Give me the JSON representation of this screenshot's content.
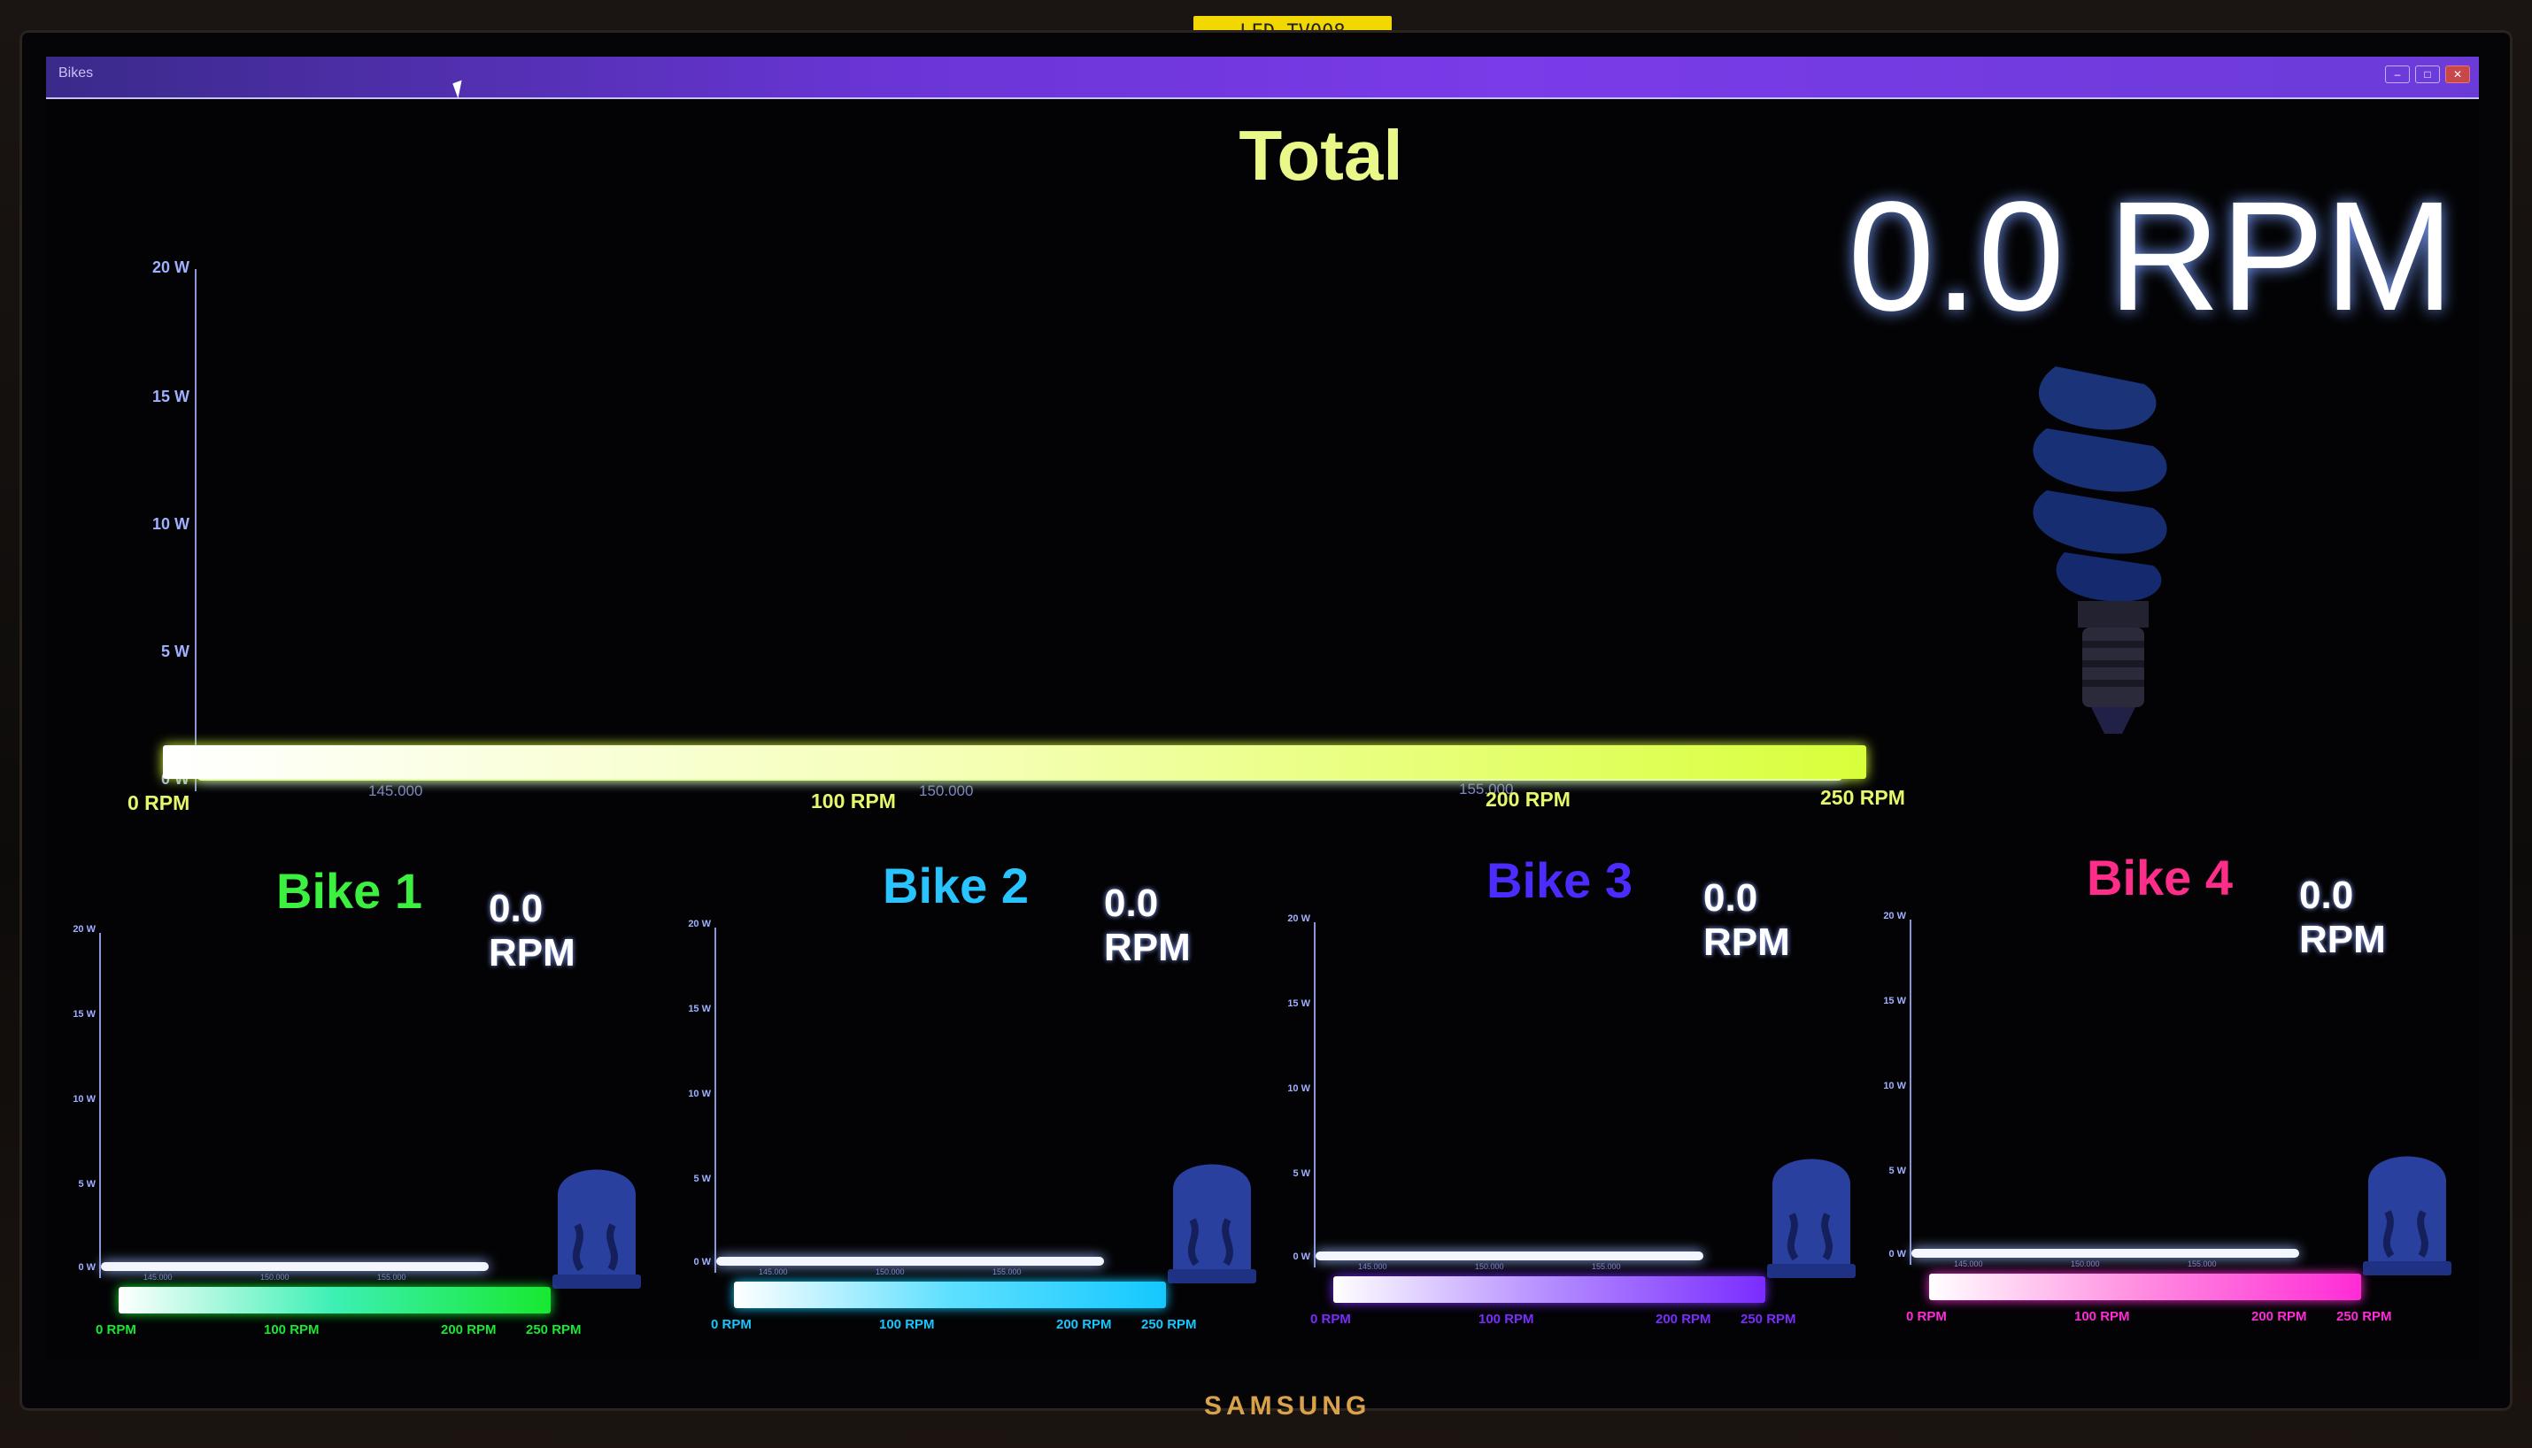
{
  "monitor": {
    "asset_tag": "LED TV008",
    "brand": "SAMSUNG"
  },
  "window": {
    "title": "Bikes",
    "controls": [
      "–",
      "□",
      "✕"
    ]
  },
  "total": {
    "title": "Total",
    "rpm_display": "0.0 RPM",
    "icon": "lightbulb-icon",
    "power_chart": {
      "y_ticks": [
        "20 W",
        "15 W",
        "10 W",
        "5 W",
        "0 W"
      ],
      "x_ticks": [
        "145.000",
        "150.000",
        "155.000"
      ],
      "power_w": 0
    },
    "rpm_bar": {
      "labels": [
        "0 RPM",
        "100 RPM",
        "200 RPM",
        "250 RPM"
      ],
      "rpm": 0,
      "max_rpm": 250,
      "gradient": [
        "#ffffff",
        "#f4ffb0",
        "#d8ff3a"
      ]
    },
    "accent": "#eaf88a"
  },
  "bikes": [
    {
      "title": "Bike 1",
      "rpm_display": "0.0 RPM",
      "color": "#3cf040",
      "icon": "led-icon",
      "y_ticks": [
        "20 W",
        "15 W",
        "10 W",
        "5 W",
        "0 W"
      ],
      "x_ticks": [
        "145.000",
        "150.000",
        "155.000"
      ],
      "rpm_labels": [
        "0 RPM",
        "100 RPM",
        "200 RPM",
        "250 RPM"
      ],
      "gradient": [
        "#ffffff",
        "#3cf0b4",
        "#18e830"
      ]
    },
    {
      "title": "Bike 2",
      "rpm_display": "0.0 RPM",
      "color": "#27c4ff",
      "icon": "led-icon",
      "y_ticks": [
        "20 W",
        "15 W",
        "10 W",
        "5 W",
        "0 W"
      ],
      "x_ticks": [
        "145.000",
        "150.000",
        "155.000"
      ],
      "rpm_labels": [
        "0 RPM",
        "100 RPM",
        "200 RPM",
        "250 RPM"
      ],
      "gradient": [
        "#ffffff",
        "#5ee0ff",
        "#14c8ff"
      ]
    },
    {
      "title": "Bike 3",
      "rpm_display": "0.0 RPM",
      "color": "#4b2cff",
      "icon": "led-icon",
      "y_ticks": [
        "20 W",
        "15 W",
        "10 W",
        "5 W",
        "0 W"
      ],
      "x_ticks": [
        "145.000",
        "150.000",
        "155.000"
      ],
      "rpm_labels": [
        "0 RPM",
        "100 RPM",
        "200 RPM",
        "250 RPM"
      ],
      "gradient": [
        "#ffffff",
        "#b48cff",
        "#7a2cff"
      ]
    },
    {
      "title": "Bike 4",
      "rpm_display": "0.0 RPM",
      "color": "#ff2d8a",
      "icon": "led-icon",
      "y_ticks": [
        "20 W",
        "15 W",
        "10 W",
        "5 W",
        "0 W"
      ],
      "x_ticks": [
        "145.000",
        "150.000",
        "155.000"
      ],
      "rpm_labels": [
        "0 RPM",
        "100 RPM",
        "200 RPM",
        "250 RPM"
      ],
      "gradient": [
        "#ffffff",
        "#ff8ae0",
        "#ff2bd6"
      ]
    }
  ]
}
